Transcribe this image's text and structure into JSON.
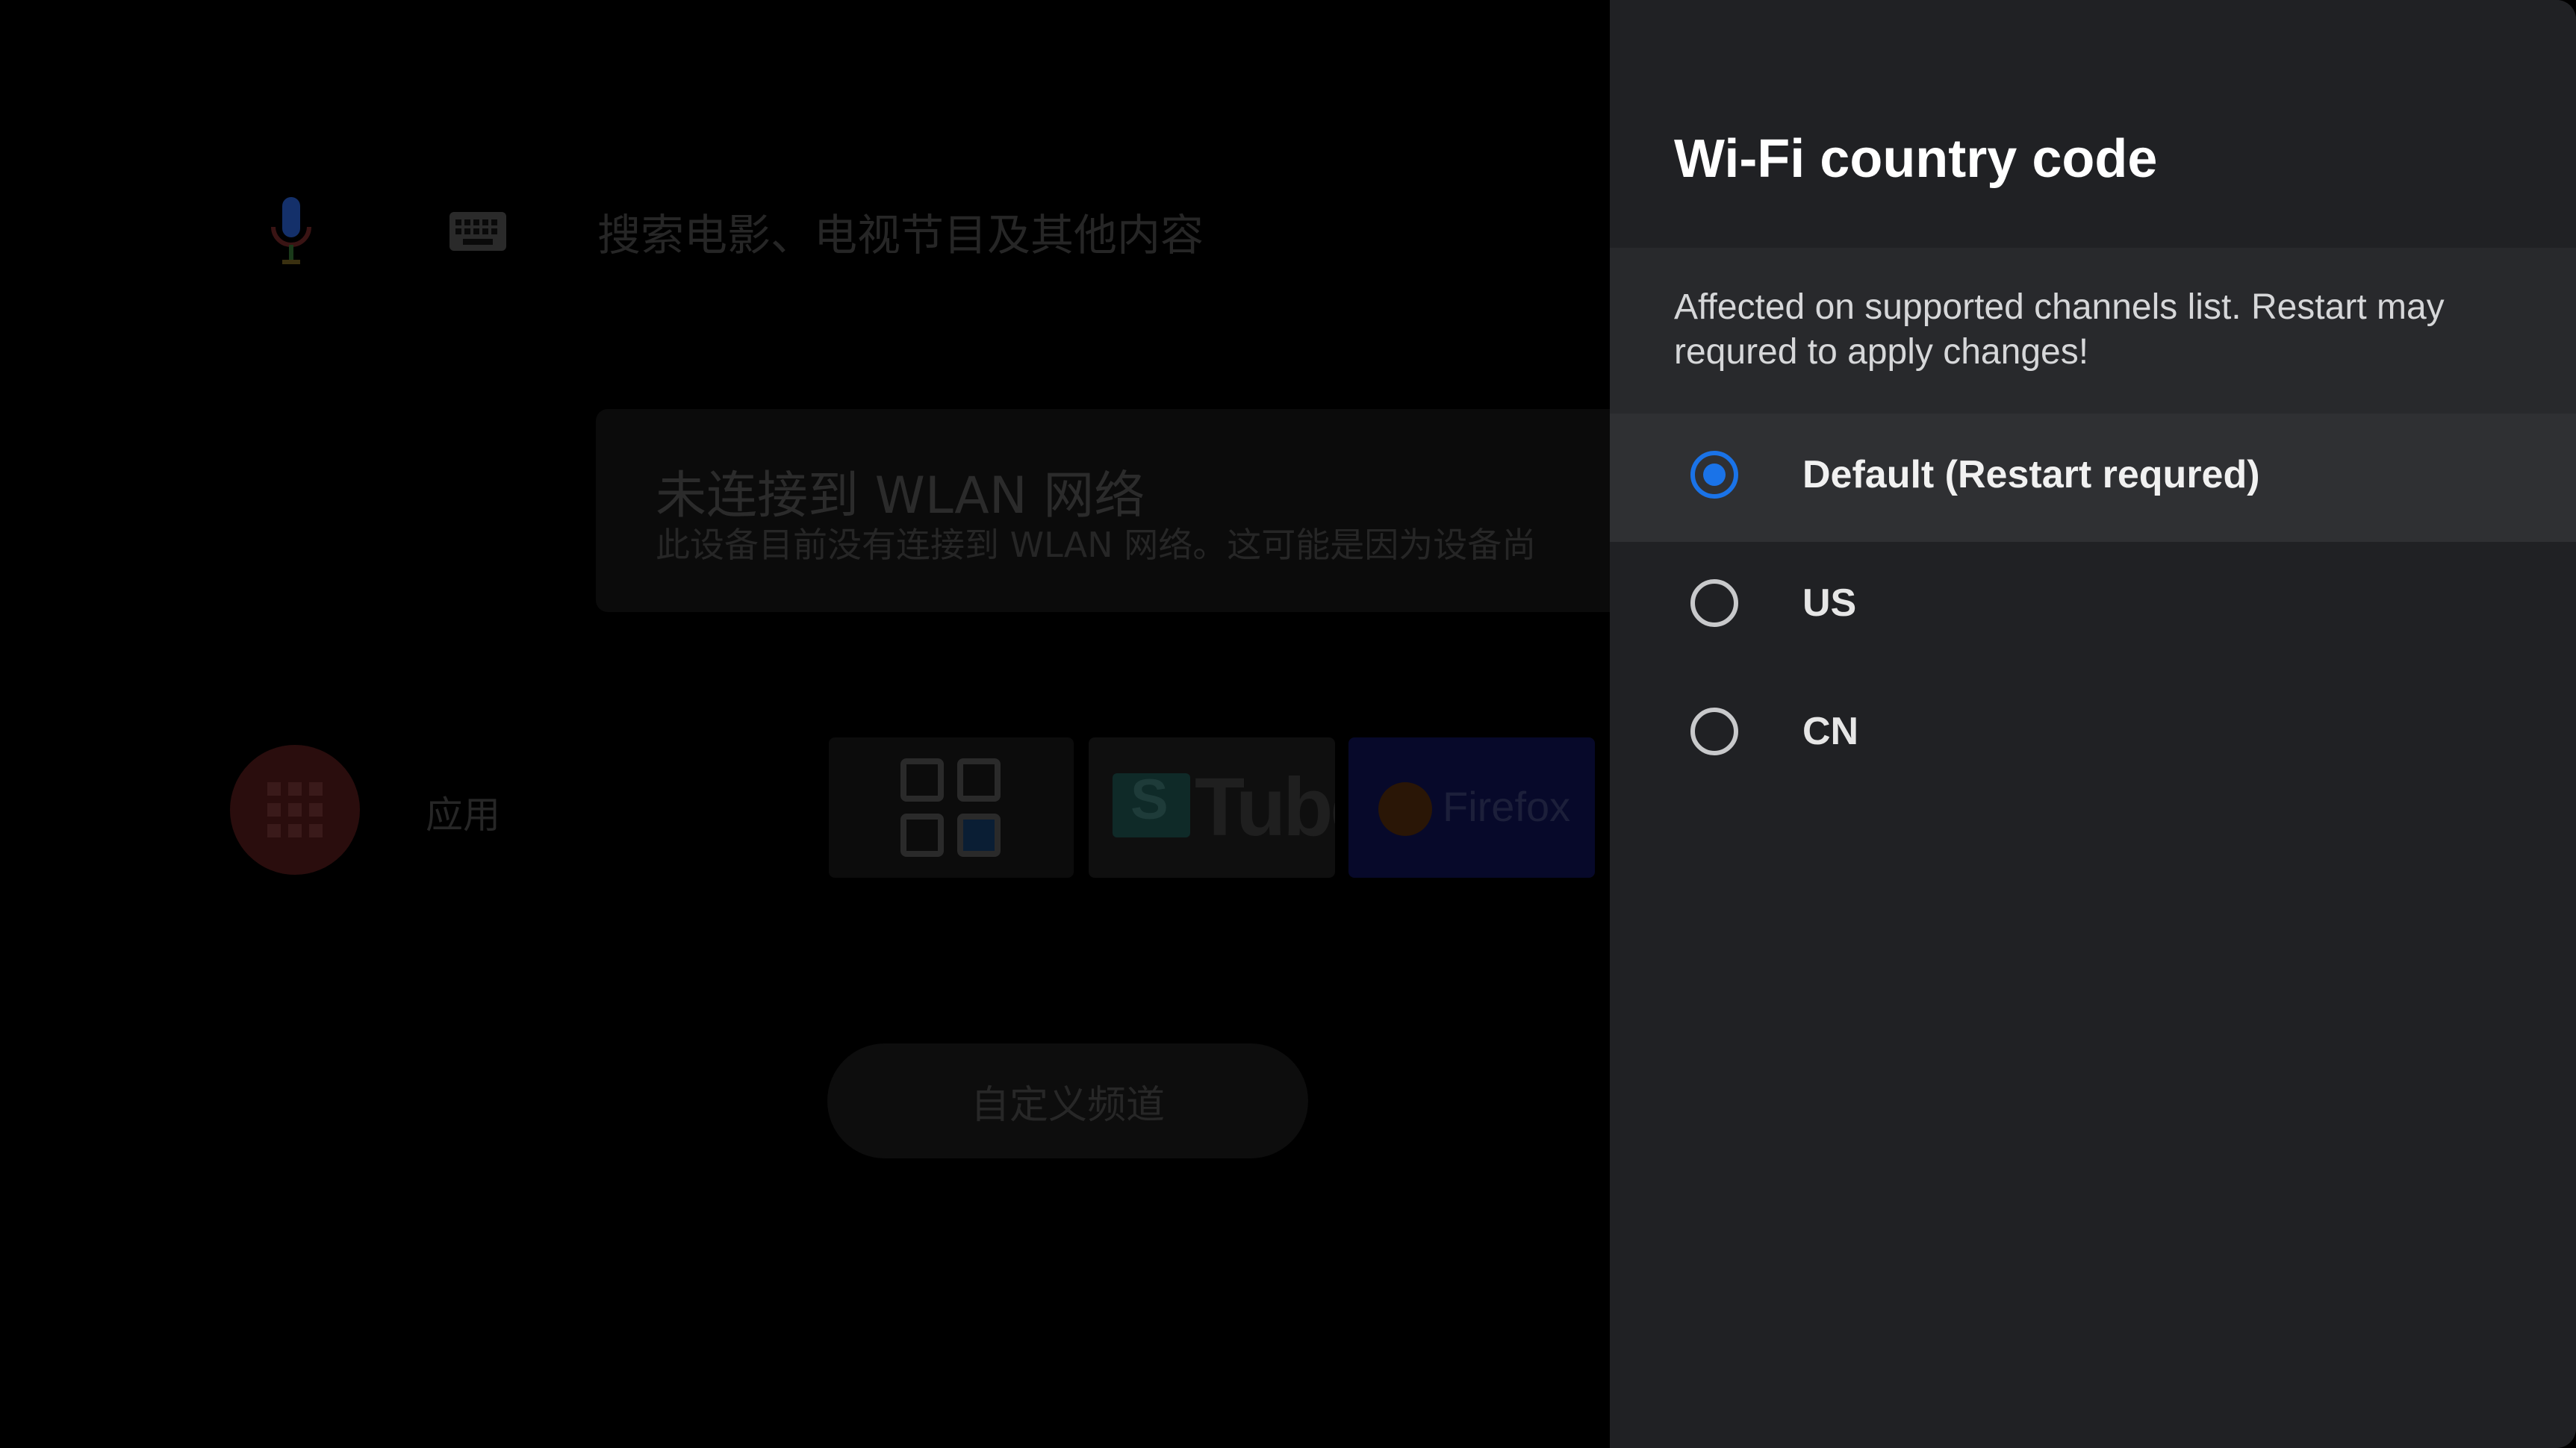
{
  "launcher": {
    "search_placeholder": "搜索电影、电视节目及其他内容",
    "wlan_title": "未连接到 WLAN 网络",
    "wlan_message": "此设备目前没有连接到 WLAN 网络。这可能是因为设备尚",
    "apps_label": "应用",
    "tiles": [
      {
        "name": "apps-grid",
        "icon": "grid-icon"
      },
      {
        "name": "youtube",
        "text": "Tube",
        "badge": "S"
      },
      {
        "name": "firefox",
        "text": "Firefox"
      }
    ],
    "customize_label": "自定义频道"
  },
  "panel": {
    "title": "Wi-Fi country code",
    "description": "Affected on supported channels list. Restart may requred to apply changes!",
    "options": [
      {
        "label": "Default (Restart requred)",
        "checked": true
      },
      {
        "label": "US",
        "checked": false
      },
      {
        "label": "CN",
        "checked": false
      }
    ]
  },
  "colors": {
    "panel_bg": "#202124",
    "accent": "#1a73e8",
    "selected_row": "#2f3033"
  }
}
